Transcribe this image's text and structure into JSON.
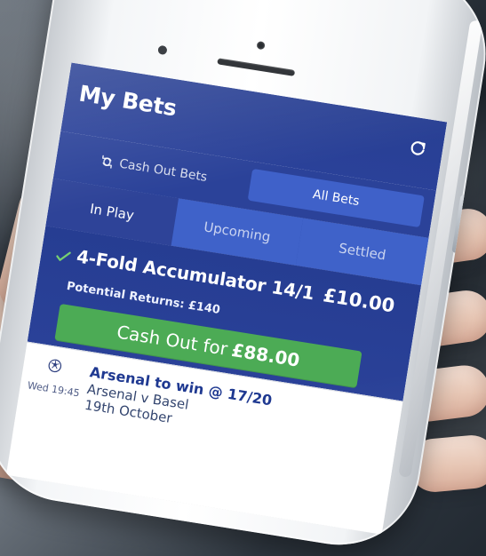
{
  "screen": {
    "title": "My Bets"
  },
  "top_tabs": [
    {
      "label": "Cash Out Bets",
      "active": false
    },
    {
      "label": "All Bets",
      "active": true
    }
  ],
  "status_tabs": [
    {
      "label": "In Play",
      "active": true
    },
    {
      "label": "Upcoming",
      "active": false
    },
    {
      "label": "Settled",
      "active": false
    }
  ],
  "bet": {
    "title": "4-Fold Accumulator 14/1",
    "stake": "£10.00",
    "returns": "Potential Returns: £140",
    "cashout_prefix": "Cash Out for",
    "cashout_amount": "£88.00"
  },
  "fixture": {
    "kickoff": "Wed 19:45",
    "title": "Arsenal to win @ 17/20",
    "match": "Arsenal v Basel",
    "date": "19th October"
  },
  "icons": {
    "refresh": "refresh-icon",
    "cash_out": "cash-out-icon",
    "check": "check-icon",
    "football": "football-icon"
  },
  "colors": {
    "primary_blue": "#2a4198",
    "tab_blue": "#3f62c9",
    "success_green": "#4cab55",
    "fixture_text": "#1f3991"
  }
}
